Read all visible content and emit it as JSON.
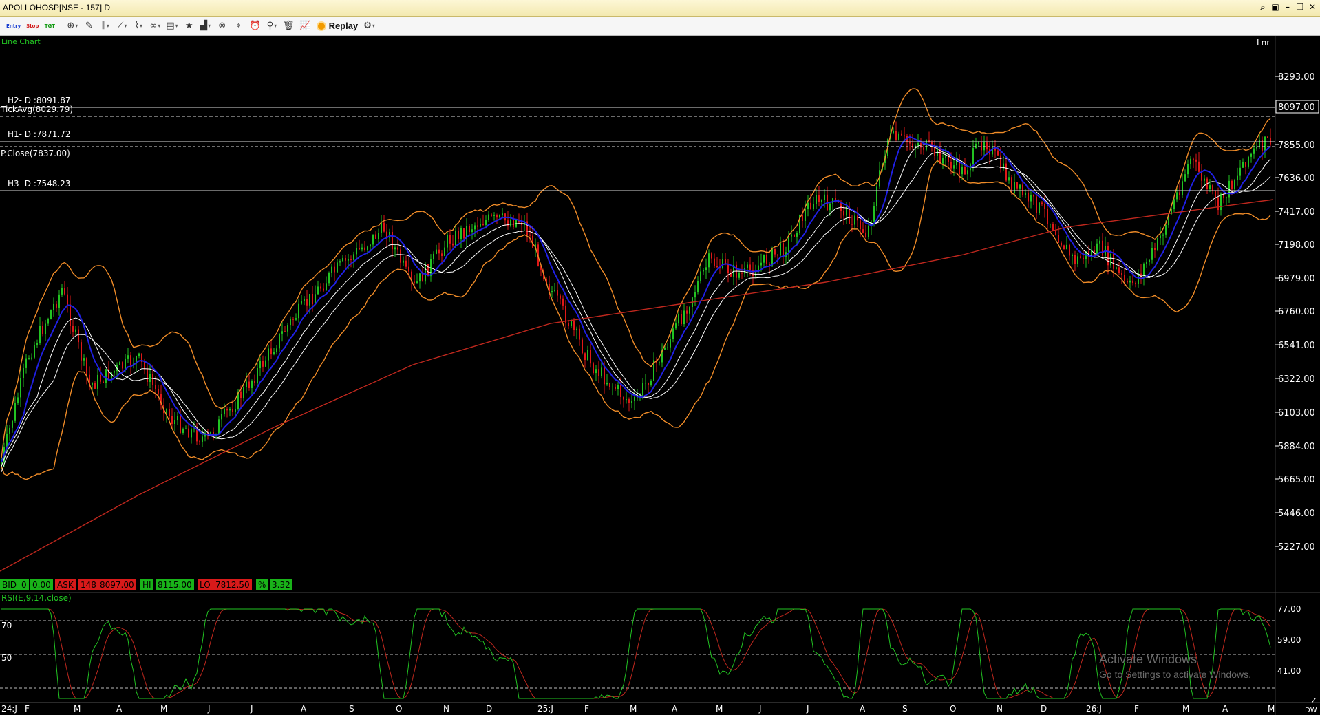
{
  "window": {
    "title": "APOLLOHOSP[NSE - 157] D",
    "controls": [
      "⌕",
      "▣",
      "–",
      "❐",
      "✕"
    ]
  },
  "toolbar": {
    "entry_label": "Entry",
    "stop_label": "Stop",
    "tgt_label": "TGT",
    "replay_label": "Replay",
    "icons": [
      "cursor-icon",
      "pencil-icon",
      "candle-icon",
      "line-tools-icon",
      "fib-icon",
      "indicator-icon",
      "template-icon",
      "star-icon",
      "study-icon",
      "compare-icon",
      "scan-icon",
      "alert-icon",
      "zoom-icon",
      "delete-icon",
      "chart-line-icon"
    ]
  },
  "chart": {
    "header_label": "Line Chart",
    "scale_label": "Lnr",
    "price_axis": [
      "8293.00",
      "7855.00",
      "7636.00",
      "7417.00",
      "7198.00",
      "6979.00",
      "6760.00",
      "6541.00",
      "6322.00",
      "6103.00",
      "5884.00",
      "5665.00",
      "5446.00",
      "5227.00"
    ],
    "current_price": "8097.00",
    "levels": {
      "h2": "H2- D :8091.87",
      "tickavg": "TickAvg(8029.79)",
      "h1": "H1- D :7871.72",
      "pclose": "P.Close(7837.00)",
      "h3": "H3- D :7548.23"
    }
  },
  "quote_bar": {
    "bid_label": "BID",
    "bid_qty": "0",
    "bid_price": "0.00",
    "ask_label": "ASK",
    "ask_qty": "148",
    "ask_price": "8097.00",
    "hi_label": "HI",
    "hi_price": "8115.00",
    "lo_label": "LO",
    "lo_price": "7812.50",
    "pct_label": "%",
    "pct_value": "3.32"
  },
  "rsi": {
    "label": "RSI(E,9,14,close)",
    "levels_left": [
      "70",
      "50"
    ],
    "axis": [
      "77.00",
      "59.00",
      "41.00"
    ]
  },
  "x_axis": [
    "24:J",
    "F",
    "M",
    "A",
    "M",
    "J",
    "J",
    "A",
    "S",
    "O",
    "N",
    "D",
    "25:J",
    "F",
    "M",
    "A",
    "M",
    "J",
    "J",
    "A",
    "S",
    "O",
    "N",
    "D",
    "26:J",
    "F",
    "M",
    "A",
    "M"
  ],
  "corner": {
    "z": "Z",
    "dw": "DW"
  },
  "watermark": {
    "line1": "Activate Windows",
    "line2": "Go to Settings to activate Windows."
  },
  "colors": {
    "candle_up": "#22c322",
    "candle_down": "#e01818",
    "bollinger": "#f08c28",
    "ema_fast": "#2020e6",
    "ma_white": "#ffffff",
    "ma_red": "#c0281e",
    "rsi_line": "#22c322",
    "rsi_signal": "#c0281e"
  }
}
